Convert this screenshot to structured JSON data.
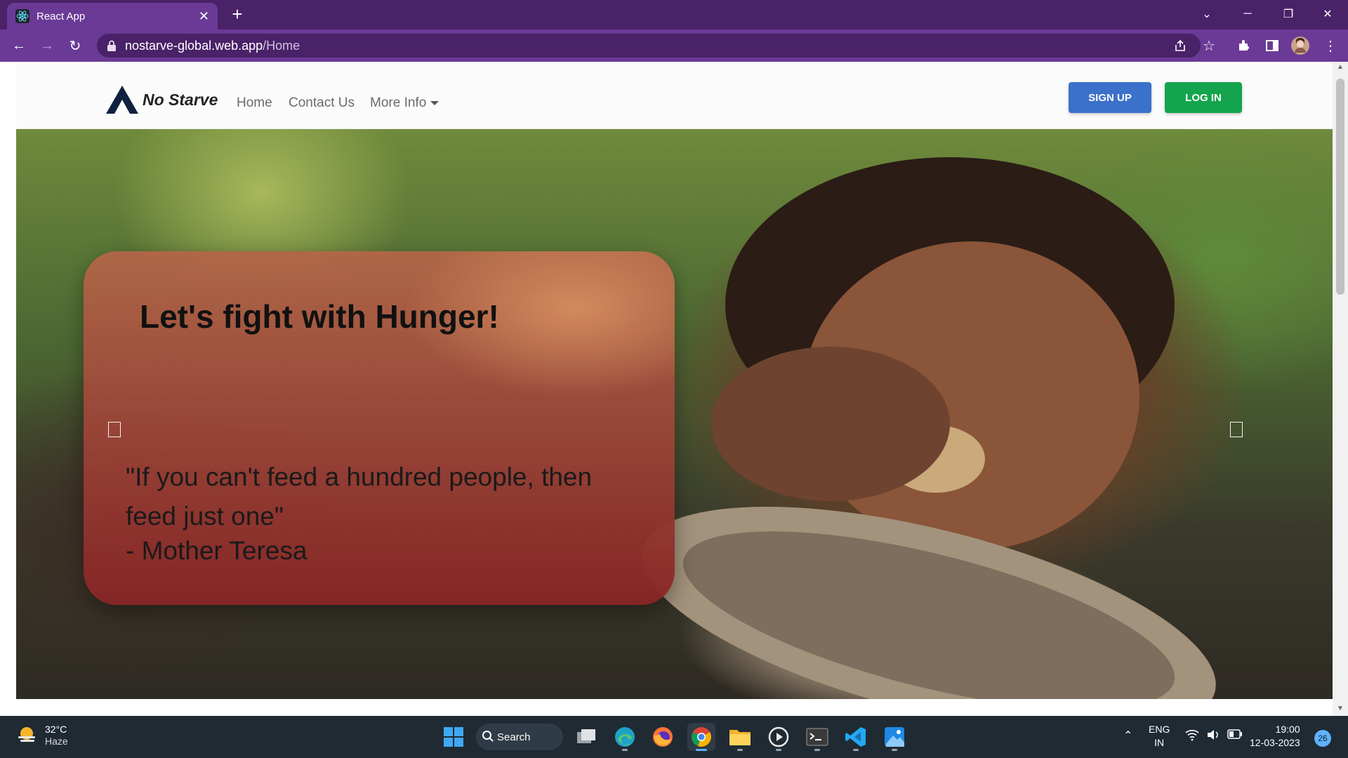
{
  "browser": {
    "tab_title": "React App",
    "url_host": "nostarve-global.web.app",
    "url_path": "/Home"
  },
  "navbar": {
    "brand": "No Starve",
    "links": [
      "Home",
      "Contact Us",
      "More Info"
    ],
    "signup_label": "SIGN UP",
    "login_label": "LOG IN"
  },
  "hero": {
    "title": "Let's fight with Hunger!",
    "quote": "\"If you can't feed a hundred people, then feed just one\"",
    "author": "- Mother Teresa"
  },
  "taskbar": {
    "temperature": "32°C",
    "condition": "Haze",
    "search_label": "Search",
    "lang_top": "ENG",
    "lang_bottom": "IN",
    "time": "19:00",
    "date": "12-03-2023",
    "notification_count": "26"
  },
  "colors": {
    "browser_frame": "#4a2268",
    "browser_toolbar": "#6a3a96",
    "signup": "#3b71ca",
    "login": "#14a44d",
    "quote_card": "#9e483a",
    "taskbar": "#202a33"
  },
  "icons": [
    "react-favicon-icon",
    "close-icon",
    "plus-icon",
    "back-icon",
    "forward-icon",
    "reload-icon",
    "lock-icon",
    "share-icon",
    "star-icon",
    "extensions-icon",
    "side-panel-icon",
    "profile-avatar",
    "menu-dots-icon",
    "weather-sun-icon",
    "windows-start-icon",
    "search-icon",
    "task-view-icon",
    "edge-icon",
    "firefox-icon",
    "chrome-icon",
    "file-explorer-icon",
    "media-player-icon",
    "terminal-icon",
    "vscode-icon",
    "photos-icon",
    "chevron-up-icon",
    "wifi-icon",
    "speaker-icon",
    "battery-icon"
  ]
}
